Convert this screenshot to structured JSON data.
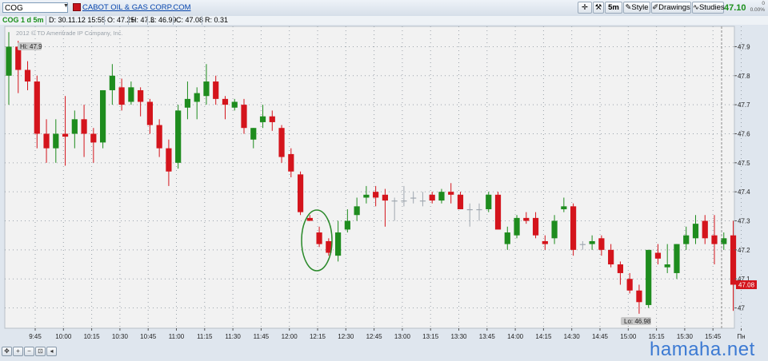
{
  "toolbar": {
    "symbol": "COG",
    "company_name": "CABOT OIL & GAS CORP.COM",
    "timeframe_label": "5m",
    "style_label": "Style",
    "drawings_label": "Drawings",
    "studies_label": "Studies",
    "last_price": "47.10",
    "change": "0",
    "change_pct": "0.00%"
  },
  "info_bar": {
    "chart_label": "COG 1 d 5m",
    "date": "D: 30.11.12 15:55",
    "open": "O: 47.25",
    "high": "H: 47.3",
    "low": "L: 46.99",
    "close": "C: 47.08",
    "range": "R: 0.31"
  },
  "watermark_chart": "2012 © TD Ameritrade IP Company, Inc.",
  "hi_label": "Hi: 47.9",
  "lo_label": "Lo: 46.98",
  "current_price_label": "47.08",
  "site_watermark": "hamaha.net",
  "colors": {
    "up": "#1e8c1e",
    "down": "#d4141c",
    "flat": "#a0a8b0",
    "circle": "#2b8a2b"
  },
  "icons": [
    "cross-icon",
    "wrench-icon",
    "lock-icon",
    "zoom-in-icon",
    "zoom-out-icon",
    "pan-icon"
  ],
  "chart_data": {
    "type": "candlestick",
    "ylim": [
      46.93,
      47.97
    ],
    "yticks": [
      "47.9",
      "47.8",
      "47.7",
      "47.6",
      "47.5",
      "47.4",
      "47.3",
      "47.2",
      "47.1",
      "47"
    ],
    "xticks": [
      "9:45",
      "10:00",
      "10:15",
      "10:30",
      "10:45",
      "11:00",
      "11:15",
      "11:30",
      "11:45",
      "12:00",
      "12:15",
      "12:30",
      "12:45",
      "13:00",
      "13:15",
      "13:30",
      "13:45",
      "14:00",
      "14:15",
      "14:30",
      "14:45",
      "15:00",
      "15:15",
      "15:30",
      "15:45",
      "Пн"
    ],
    "hi": 47.9,
    "lo": 46.98,
    "last": 47.08,
    "candles": [
      {
        "o": 47.8,
        "h": 47.95,
        "l": 47.7,
        "c": 47.9
      },
      {
        "o": 47.9,
        "h": 47.92,
        "l": 47.74,
        "c": 47.82
      },
      {
        "o": 47.82,
        "h": 47.85,
        "l": 47.75,
        "c": 47.78
      },
      {
        "o": 47.78,
        "h": 47.8,
        "l": 47.55,
        "c": 47.6
      },
      {
        "o": 47.6,
        "h": 47.65,
        "l": 47.5,
        "c": 47.55
      },
      {
        "o": 47.55,
        "h": 47.65,
        "l": 47.5,
        "c": 47.6
      },
      {
        "o": 47.6,
        "h": 47.73,
        "l": 47.49,
        "c": 47.59
      },
      {
        "o": 47.6,
        "h": 47.68,
        "l": 47.55,
        "c": 47.65
      },
      {
        "o": 47.65,
        "h": 47.7,
        "l": 47.52,
        "c": 47.6
      },
      {
        "o": 47.6,
        "h": 47.62,
        "l": 47.5,
        "c": 47.57
      },
      {
        "o": 47.57,
        "h": 47.75,
        "l": 47.55,
        "c": 47.75
      },
      {
        "o": 47.75,
        "h": 47.84,
        "l": 47.7,
        "c": 47.8
      },
      {
        "o": 47.76,
        "h": 47.79,
        "l": 47.68,
        "c": 47.7
      },
      {
        "o": 47.71,
        "h": 47.78,
        "l": 47.7,
        "c": 47.76
      },
      {
        "o": 47.75,
        "h": 47.76,
        "l": 47.66,
        "c": 47.71
      },
      {
        "o": 47.71,
        "h": 47.72,
        "l": 47.6,
        "c": 47.63
      },
      {
        "o": 47.63,
        "h": 47.65,
        "l": 47.52,
        "c": 47.55
      },
      {
        "o": 47.55,
        "h": 47.58,
        "l": 47.42,
        "c": 47.47
      },
      {
        "o": 47.5,
        "h": 47.7,
        "l": 47.48,
        "c": 47.68
      },
      {
        "o": 47.69,
        "h": 47.78,
        "l": 47.65,
        "c": 47.72
      },
      {
        "o": 47.71,
        "h": 47.76,
        "l": 47.65,
        "c": 47.74
      },
      {
        "o": 47.73,
        "h": 47.84,
        "l": 47.7,
        "c": 47.78
      },
      {
        "o": 47.78,
        "h": 47.8,
        "l": 47.7,
        "c": 47.72
      },
      {
        "o": 47.72,
        "h": 47.73,
        "l": 47.65,
        "c": 47.7
      },
      {
        "o": 47.69,
        "h": 47.72,
        "l": 47.68,
        "c": 47.71
      },
      {
        "o": 47.7,
        "h": 47.72,
        "l": 47.6,
        "c": 47.62
      },
      {
        "o": 47.58,
        "h": 47.62,
        "l": 47.55,
        "c": 47.62
      },
      {
        "o": 47.64,
        "h": 47.7,
        "l": 47.62,
        "c": 47.66
      },
      {
        "o": 47.66,
        "h": 47.68,
        "l": 47.61,
        "c": 47.64
      },
      {
        "o": 47.62,
        "h": 47.63,
        "l": 47.5,
        "c": 47.52
      },
      {
        "o": 47.53,
        "h": 47.55,
        "l": 47.45,
        "c": 47.47
      },
      {
        "o": 47.46,
        "h": 47.47,
        "l": 47.32,
        "c": 47.33
      },
      {
        "o": 47.31,
        "h": 47.32,
        "l": 47.3,
        "c": 47.3
      },
      {
        "o": 47.26,
        "h": 47.28,
        "l": 47.21,
        "c": 47.22
      },
      {
        "o": 47.23,
        "h": 47.24,
        "l": 47.18,
        "c": 47.19
      },
      {
        "o": 47.18,
        "h": 47.3,
        "l": 47.16,
        "c": 47.26
      },
      {
        "o": 47.27,
        "h": 47.34,
        "l": 47.26,
        "c": 47.3
      },
      {
        "o": 47.32,
        "h": 47.38,
        "l": 47.3,
        "c": 47.35
      },
      {
        "o": 47.38,
        "h": 47.42,
        "l": 47.36,
        "c": 47.39
      },
      {
        "o": 47.4,
        "h": 47.42,
        "l": 47.35,
        "c": 47.38
      },
      {
        "o": 47.39,
        "h": 47.41,
        "l": 47.28,
        "c": 47.37
      },
      {
        "o": 47.37,
        "h": 47.38,
        "l": 47.3,
        "c": 47.37
      },
      {
        "o": 47.37,
        "h": 47.42,
        "l": 47.35,
        "c": 47.37
      },
      {
        "o": 47.38,
        "h": 47.4,
        "l": 47.36,
        "c": 47.38
      },
      {
        "o": 47.37,
        "h": 47.4,
        "l": 47.35,
        "c": 47.37
      },
      {
        "o": 47.39,
        "h": 47.4,
        "l": 47.36,
        "c": 47.37
      },
      {
        "o": 47.37,
        "h": 47.41,
        "l": 47.36,
        "c": 47.4
      },
      {
        "o": 47.4,
        "h": 47.43,
        "l": 47.36,
        "c": 47.39
      },
      {
        "o": 47.39,
        "h": 47.4,
        "l": 47.34,
        "c": 47.34
      },
      {
        "o": 47.34,
        "h": 47.36,
        "l": 47.28,
        "c": 47.34
      },
      {
        "o": 47.34,
        "h": 47.36,
        "l": 47.3,
        "c": 47.34
      },
      {
        "o": 47.34,
        "h": 47.4,
        "l": 47.33,
        "c": 47.39
      },
      {
        "o": 47.39,
        "h": 47.4,
        "l": 47.28,
        "c": 47.27
      },
      {
        "o": 47.22,
        "h": 47.28,
        "l": 47.2,
        "c": 47.26
      },
      {
        "o": 47.25,
        "h": 47.32,
        "l": 47.24,
        "c": 47.31
      },
      {
        "o": 47.31,
        "h": 47.33,
        "l": 47.29,
        "c": 47.3
      },
      {
        "o": 47.31,
        "h": 47.33,
        "l": 47.24,
        "c": 47.25
      },
      {
        "o": 47.23,
        "h": 47.25,
        "l": 47.2,
        "c": 47.22
      },
      {
        "o": 47.24,
        "h": 47.32,
        "l": 47.22,
        "c": 47.3
      },
      {
        "o": 47.34,
        "h": 47.38,
        "l": 47.33,
        "c": 47.35
      },
      {
        "o": 47.35,
        "h": 47.36,
        "l": 47.18,
        "c": 47.2
      },
      {
        "o": 47.22,
        "h": 47.23,
        "l": 47.2,
        "c": 47.22
      },
      {
        "o": 47.22,
        "h": 47.25,
        "l": 47.2,
        "c": 47.23
      },
      {
        "o": 47.24,
        "h": 47.25,
        "l": 47.18,
        "c": 47.2
      },
      {
        "o": 47.2,
        "h": 47.22,
        "l": 47.14,
        "c": 47.15
      },
      {
        "o": 47.15,
        "h": 47.16,
        "l": 47.08,
        "c": 47.12
      },
      {
        "o": 47.1,
        "h": 47.12,
        "l": 47.05,
        "c": 47.06
      },
      {
        "o": 47.06,
        "h": 47.08,
        "l": 46.98,
        "c": 47.02
      },
      {
        "o": 47.01,
        "h": 47.2,
        "l": 47.0,
        "c": 47.2
      },
      {
        "o": 47.19,
        "h": 47.22,
        "l": 47.15,
        "c": 47.17
      },
      {
        "o": 47.14,
        "h": 47.22,
        "l": 47.12,
        "c": 47.15
      },
      {
        "o": 47.12,
        "h": 47.22,
        "l": 47.1,
        "c": 47.22
      },
      {
        "o": 47.22,
        "h": 47.28,
        "l": 47.2,
        "c": 47.25
      },
      {
        "o": 47.24,
        "h": 47.32,
        "l": 47.22,
        "c": 47.29
      },
      {
        "o": 47.3,
        "h": 47.32,
        "l": 47.22,
        "c": 47.24
      },
      {
        "o": 47.25,
        "h": 47.32,
        "l": 47.15,
        "c": 47.22
      },
      {
        "o": 47.22,
        "h": 47.26,
        "l": 47.2,
        "c": 47.24
      },
      {
        "o": 47.25,
        "h": 47.3,
        "l": 46.99,
        "c": 47.08
      }
    ]
  }
}
